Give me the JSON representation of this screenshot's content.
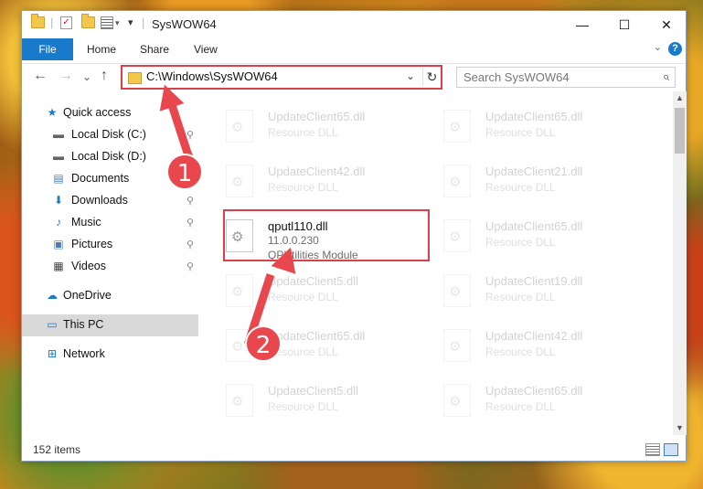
{
  "window": {
    "title": "SysWOW64",
    "minimize": "—",
    "maximize": "☐",
    "close": "✕"
  },
  "ribbon": {
    "file_tab": "File",
    "tabs": [
      "Home",
      "Share",
      "View"
    ],
    "help": "?",
    "expand": "⌄"
  },
  "nav": {
    "back": "←",
    "forward": "→",
    "recent": "⌄",
    "up": "↑",
    "address": "C:\\Windows\\SysWOW64",
    "address_dropdown": "⌄",
    "refresh": "↻",
    "search_placeholder": "Search SysWOW64",
    "search_icon": "⌕"
  },
  "sidebar": {
    "items": [
      {
        "label": "Quick access",
        "icon": "★",
        "pinned": false
      },
      {
        "label": "Local Disk (C:)",
        "icon": "▬",
        "pinned": true
      },
      {
        "label": "Local Disk (D:)",
        "icon": "▬",
        "pinned": true
      },
      {
        "label": "Documents",
        "icon": "▤",
        "pinned": false
      },
      {
        "label": "Downloads",
        "icon": "⬇",
        "pinned": true
      },
      {
        "label": "Music",
        "icon": "♪",
        "pinned": true
      },
      {
        "label": "Pictures",
        "icon": "▣",
        "pinned": true
      },
      {
        "label": "Videos",
        "icon": "▦",
        "pinned": true
      },
      {
        "label": "OneDrive",
        "icon": "☁",
        "pinned": false
      },
      {
        "label": "This PC",
        "icon": "▭",
        "pinned": false
      },
      {
        "label": "Network",
        "icon": "⊞",
        "pinned": false
      }
    ],
    "pin_icon": "📌"
  },
  "files": [
    {
      "name": "UpdateClient65.dll",
      "desc": "Resource DLL"
    },
    {
      "name": "UpdateClient65.dll",
      "desc": "Resource DLL"
    },
    {
      "name": "UpdateClient42.dll",
      "desc": "Resource DLL"
    },
    {
      "name": "UpdateClient21.dll",
      "desc": "Resource DLL"
    },
    {
      "name": "qputl110.dll",
      "version": "11.0.0.230",
      "desc": "QPUtilities Module"
    },
    {
      "name": "UpdateClient65.dll",
      "desc": "Resource DLL"
    },
    {
      "name": "UpdateClient5.dll",
      "desc": "Resource DLL"
    },
    {
      "name": "UpdateClient19.dll",
      "desc": "Resource DLL"
    },
    {
      "name": "UpdateClient65.dll",
      "desc": "Resource DLL"
    },
    {
      "name": "UpdateClient42.dll",
      "desc": "Resource DLL"
    },
    {
      "name": "UpdateClient5.dll",
      "desc": "Resource DLL"
    },
    {
      "name": "UpdateClient65.dll",
      "desc": "Resource DLL"
    }
  ],
  "status": {
    "item_count": "152 items"
  },
  "callouts": [
    "1",
    "2"
  ],
  "colors": {
    "accent": "#1979ca",
    "highlight": "#d9404a",
    "callout": "#e8474d"
  }
}
